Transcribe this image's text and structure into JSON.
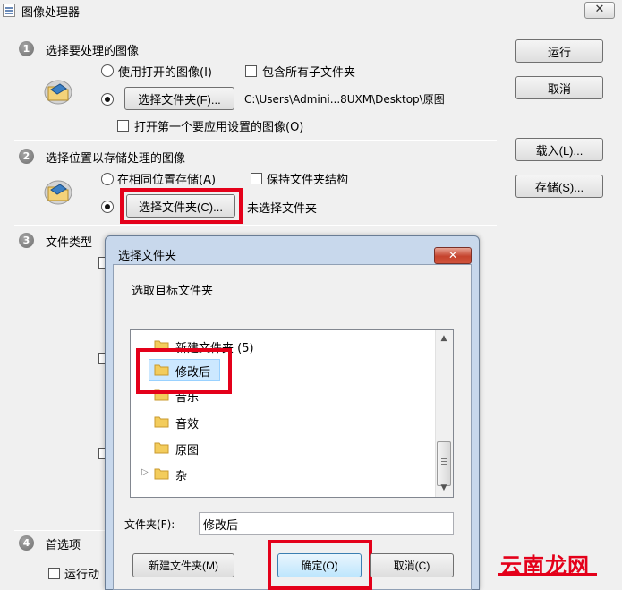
{
  "window": {
    "title": "图像处理器",
    "close_glyph": "✕"
  },
  "step1": {
    "number": "1",
    "heading": "选择要处理的图像",
    "use_open_images": "使用打开的图像(I)",
    "include_subfolders": "包含所有子文件夹",
    "select_folder_button": "选择文件夹(F)...",
    "folder_path": "C:\\Users\\Admini...8UXM\\Desktop\\原图",
    "open_first_image": "打开第一个要应用设置的图像(O)"
  },
  "step2": {
    "number": "2",
    "heading": "选择位置以存储处理的图像",
    "save_same_location": "在相同位置存储(A)",
    "keep_structure": "保持文件夹结构",
    "select_folder_button": "选择文件夹(C)...",
    "no_folder": "未选择文件夹"
  },
  "step3": {
    "number": "3",
    "heading": "文件类型"
  },
  "step4": {
    "number": "4",
    "heading": "首选项",
    "run_action": "运行动"
  },
  "side_buttons": {
    "run": "运行",
    "cancel": "取消",
    "load": "载入(L)...",
    "save": "存储(S)..."
  },
  "dialog": {
    "title": "选择文件夹",
    "close_glyph": "✕",
    "prompt": "选取目标文件夹",
    "tree_items": [
      {
        "label": "新建文件夹 (5)"
      },
      {
        "label": "修改后"
      },
      {
        "label": "音乐"
      },
      {
        "label": "音效"
      },
      {
        "label": "原图"
      },
      {
        "label": "杂"
      }
    ],
    "expand_glyph": "▷",
    "folder_label": "文件夹(F):",
    "folder_value": "修改后",
    "new_folder_button": "新建文件夹(M)",
    "ok_button": "确定(O)",
    "cancel_button": "取消(C)"
  },
  "watermark": "云南龙网",
  "colors": {
    "highlight": "#e4001a",
    "dialog_frame": "#c8d8ec",
    "selected_item": "#cce8ff"
  }
}
